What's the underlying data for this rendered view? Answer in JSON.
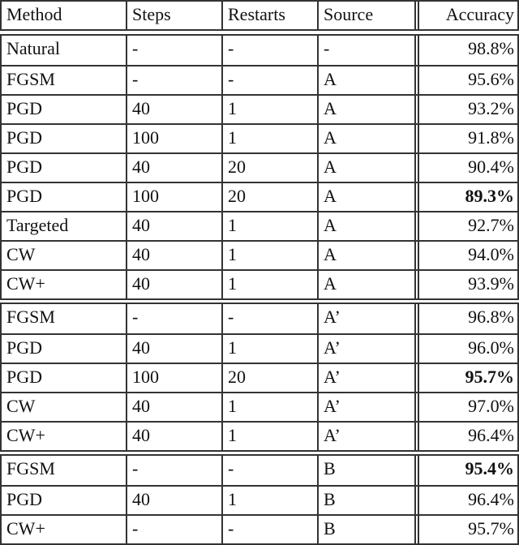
{
  "table": {
    "headers": {
      "method": "Method",
      "steps": "Steps",
      "restarts": "Restarts",
      "source": "Source",
      "accuracy": "Accuracy"
    },
    "groups": [
      {
        "rows": [
          {
            "method": "Natural",
            "steps": "-",
            "restarts": "-",
            "source": "-",
            "accuracy": "98.8%",
            "bold": false
          },
          {
            "method": "FGSM",
            "steps": "-",
            "restarts": "-",
            "source": "A",
            "accuracy": "95.6%",
            "bold": false
          },
          {
            "method": "PGD",
            "steps": "40",
            "restarts": "1",
            "source": "A",
            "accuracy": "93.2%",
            "bold": false
          },
          {
            "method": "PGD",
            "steps": "100",
            "restarts": "1",
            "source": "A",
            "accuracy": "91.8%",
            "bold": false
          },
          {
            "method": "PGD",
            "steps": "40",
            "restarts": "20",
            "source": "A",
            "accuracy": "90.4%",
            "bold": false
          },
          {
            "method": "PGD",
            "steps": "100",
            "restarts": "20",
            "source": "A",
            "accuracy": "89.3%",
            "bold": true
          },
          {
            "method": "Targeted",
            "steps": "40",
            "restarts": "1",
            "source": "A",
            "accuracy": "92.7%",
            "bold": false
          },
          {
            "method": "CW",
            "steps": "40",
            "restarts": "1",
            "source": "A",
            "accuracy": "94.0%",
            "bold": false
          },
          {
            "method": "CW+",
            "steps": "40",
            "restarts": "1",
            "source": "A",
            "accuracy": "93.9%",
            "bold": false
          }
        ]
      },
      {
        "rows": [
          {
            "method": "FGSM",
            "steps": "-",
            "restarts": "-",
            "source": "A’",
            "accuracy": "96.8%",
            "bold": false
          },
          {
            "method": "PGD",
            "steps": "40",
            "restarts": "1",
            "source": "A’",
            "accuracy": "96.0%",
            "bold": false
          },
          {
            "method": "PGD",
            "steps": "100",
            "restarts": "20",
            "source": "A’",
            "accuracy": "95.7%",
            "bold": true
          },
          {
            "method": "CW",
            "steps": "40",
            "restarts": "1",
            "source": "A’",
            "accuracy": "97.0%",
            "bold": false
          },
          {
            "method": "CW+",
            "steps": "40",
            "restarts": "1",
            "source": "A’",
            "accuracy": "96.4%",
            "bold": false
          }
        ]
      },
      {
        "rows": [
          {
            "method": "FGSM",
            "steps": "-",
            "restarts": "-",
            "source": "B",
            "accuracy": "95.4%",
            "bold": true
          },
          {
            "method": "PGD",
            "steps": "40",
            "restarts": "1",
            "source": "B",
            "accuracy": "96.4%",
            "bold": false
          },
          {
            "method": "CW+",
            "steps": "-",
            "restarts": "-",
            "source": "B",
            "accuracy": "95.7%",
            "bold": false
          }
        ]
      }
    ]
  }
}
